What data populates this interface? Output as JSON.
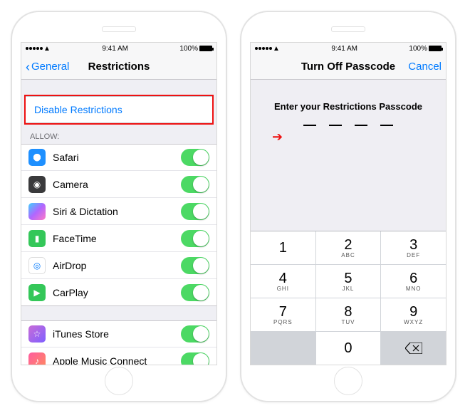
{
  "status": {
    "time": "9:41 AM",
    "battery": "100%"
  },
  "left": {
    "back_label": "General",
    "title": "Restrictions",
    "disable_label": "Disable Restrictions",
    "allow_header": "ALLOW:",
    "apps": [
      {
        "label": "Safari"
      },
      {
        "label": "Camera"
      },
      {
        "label": "Siri & Dictation"
      },
      {
        "label": "FaceTime"
      },
      {
        "label": "AirDrop"
      },
      {
        "label": "CarPlay"
      }
    ],
    "apps2": [
      {
        "label": "iTunes Store"
      },
      {
        "label": "Apple Music Connect"
      }
    ]
  },
  "right": {
    "title": "Turn Off Passcode",
    "cancel": "Cancel",
    "prompt": "Enter your Restrictions Passcode",
    "keys": [
      {
        "n": "1",
        "l": ""
      },
      {
        "n": "2",
        "l": "ABC"
      },
      {
        "n": "3",
        "l": "DEF"
      },
      {
        "n": "4",
        "l": "GHI"
      },
      {
        "n": "5",
        "l": "JKL"
      },
      {
        "n": "6",
        "l": "MNO"
      },
      {
        "n": "7",
        "l": "PQRS"
      },
      {
        "n": "8",
        "l": "TUV"
      },
      {
        "n": "9",
        "l": "WXYZ"
      }
    ],
    "zero": "0"
  }
}
